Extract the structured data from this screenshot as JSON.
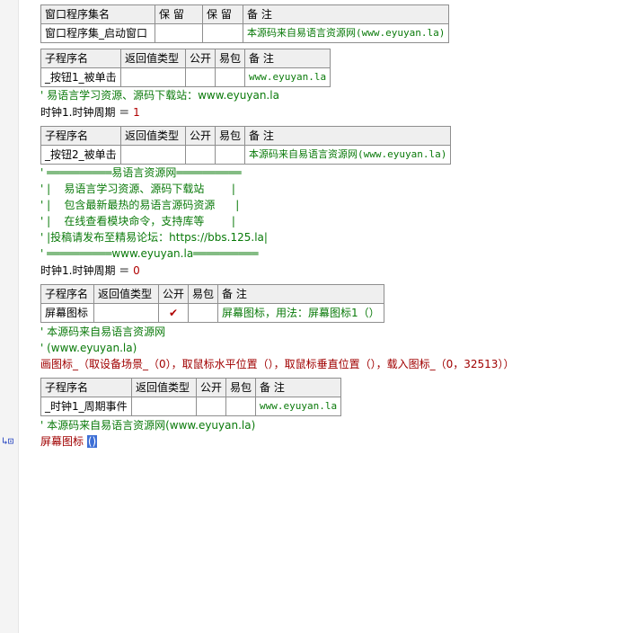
{
  "assembly_table": {
    "headers": [
      "窗口程序集名",
      "保 留",
      "保 留",
      "备 注"
    ],
    "row": [
      "窗口程序集_启动窗口",
      "",
      "",
      "本源码来自易语言资源网(www.eyuyan.la)"
    ]
  },
  "sub1": {
    "headers": [
      "子程序名",
      "返回值类型",
      "公开",
      "易包",
      "备 注"
    ],
    "row": [
      "_按钮1_被单击",
      "",
      "",
      "",
      "www.eyuyan.la"
    ]
  },
  "lines_a": {
    "comment1": "' 易语言学习资源、源码下载站：www.eyuyan.la",
    "assign_left": "时钟1.时钟周期 ＝ ",
    "assign_value": "1"
  },
  "sub2": {
    "headers": [
      "子程序名",
      "返回值类型",
      "公开",
      "易包",
      "备 注"
    ],
    "row": [
      "_按钮2_被单击",
      "",
      "",
      "",
      "本源码来自易语言资源网(www.eyuyan.la)"
    ]
  },
  "banner": [
    "' ══════════易语言资源网══════════",
    "' |    易语言学习资源、源码下载站        |",
    "' |    包含最新最热的易语言源码资源      |",
    "' |    在线查看模块命令，支持库等        |",
    "' |投稿请发布至精易论坛：https://bbs.125.la|",
    "' ══════════www.eyuyan.la══════════"
  ],
  "lines_b": {
    "assign_left": "时钟1.时钟周期 ＝ ",
    "assign_value": "0"
  },
  "sub3": {
    "headers": [
      "子程序名",
      "返回值类型",
      "公开",
      "易包",
      "备 注"
    ],
    "row": [
      "屏幕图标",
      "",
      "✔",
      "",
      "屏幕图标，用法：屏幕图标1（）"
    ]
  },
  "lines_c": {
    "comment1": "' 本源码来自易语言资源网",
    "comment2": "' (www.eyuyan.la)",
    "call": "画图标_（取设备场景_（0），取鼠标水平位置（），取鼠标垂直位置（），载入图标_（0，32513））"
  },
  "sub4": {
    "headers": [
      "子程序名",
      "返回值类型",
      "公开",
      "易包",
      "备 注"
    ],
    "row": [
      "_时钟1_周期事件",
      "",
      "",
      "",
      "www.eyuyan.la"
    ]
  },
  "lines_d": {
    "comment1": "' 本源码来自易语言资源网(www.eyuyan.la)",
    "call_name": "屏幕图标",
    "call_args": "()"
  },
  "gutter_marker": "↳⊡",
  "colors": {
    "comment": "#0a7a0a",
    "number": "#b00000",
    "selection": "#3d6fd6"
  }
}
